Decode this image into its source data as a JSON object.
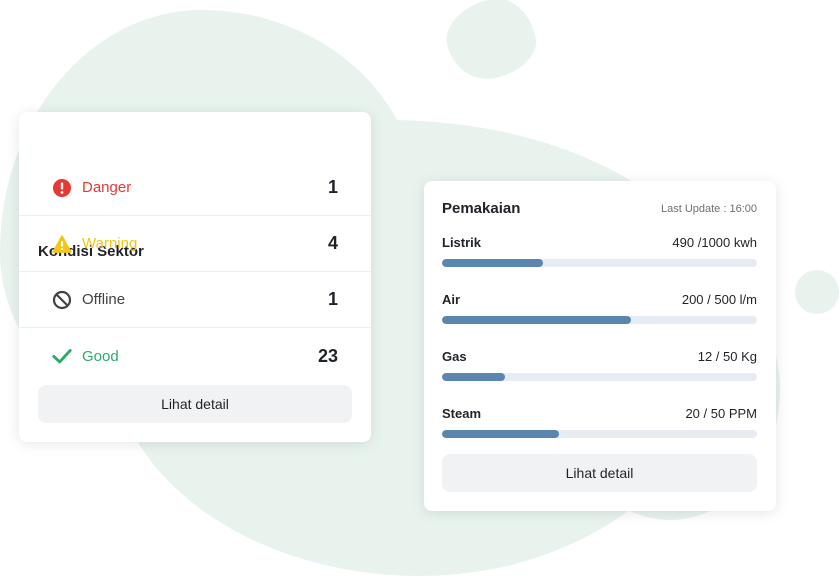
{
  "sector": {
    "title": "Kondisi Sektor",
    "rows": [
      {
        "label": "Danger",
        "count": "1",
        "color": "#e53935",
        "icon": "exclamation-circle-icon"
      },
      {
        "label": "Warning",
        "count": "4",
        "color": "#f3c614",
        "icon": "warning-triangle-icon"
      },
      {
        "label": "Offline",
        "count": "1",
        "color": "#424242",
        "icon": "prohibited-icon"
      },
      {
        "label": "Good",
        "count": "23",
        "color": "#2fa86b",
        "icon": "checkmark-icon"
      }
    ],
    "button_label": "Lihat detail"
  },
  "usage": {
    "title": "Pemakaian",
    "last_update": "Last Update : 16:00",
    "meters": [
      {
        "name": "Listrik",
        "value_text": "490 /1000 kwh",
        "fraction": 0.32
      },
      {
        "name": "Air",
        "value_text": "200 / 500 l/m",
        "fraction": 0.6
      },
      {
        "name": "Gas",
        "value_text": "12 / 50 Kg",
        "fraction": 0.2
      },
      {
        "name": "Steam",
        "value_text": "20 / 50 PPM",
        "fraction": 0.37
      }
    ],
    "button_label": "Lihat detail"
  },
  "colors": {
    "background_blob": "#e8f3ee",
    "progress_fill": "#5a86b0",
    "progress_track": "#e7ecf3"
  }
}
